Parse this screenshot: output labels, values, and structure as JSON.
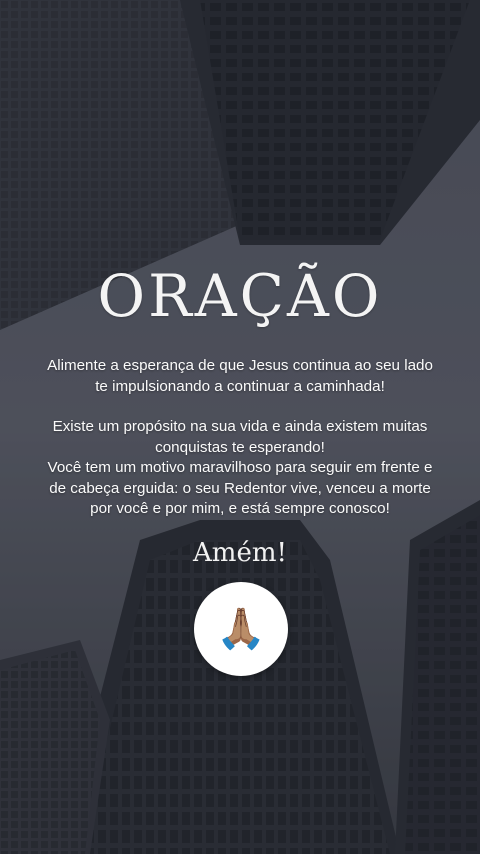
{
  "title": "ORAÇÃO",
  "paragraphs": [
    "Alimente a esperança de que Jesus continua ao seu lado te impulsionando a continuar a caminhada!",
    "Existe um propósito na sua vida e ainda existem muitas conquistas te esperando!",
    "Você tem um motivo maravilhoso para seguir em frente e de cabeça erguida: o seu Redentor vive, venceu a morte por você e por mim, e está sempre conosco!"
  ],
  "closing": "Amém!",
  "emoji": "🙏🏽",
  "icons": {
    "pray": "praying-hands-icon"
  },
  "colors": {
    "text": "#ffffff",
    "background": "#3a3d47",
    "badge": "#ffffff"
  }
}
